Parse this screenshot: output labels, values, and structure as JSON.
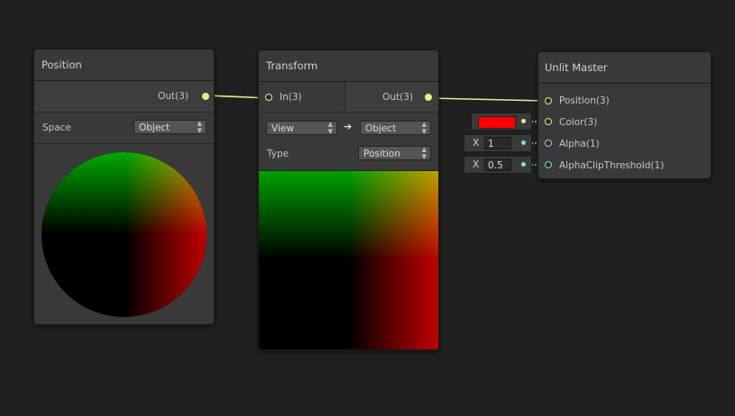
{
  "nodes": {
    "position": {
      "title": "Position",
      "out_label": "Out(3)",
      "space_label": "Space",
      "space_value": "Object"
    },
    "transform": {
      "title": "Transform",
      "in_label": "In(3)",
      "out_label": "Out(3)",
      "from_value": "View",
      "arrow": "➔",
      "to_value": "Object",
      "type_label": "Type",
      "type_value": "Position"
    },
    "unlit_master": {
      "title": "Unlit Master",
      "ports": [
        {
          "label": "Position(3)"
        },
        {
          "label": "Color(3)"
        },
        {
          "label": "Alpha(1)"
        },
        {
          "label": "AlphaClipThreshold(1)"
        }
      ]
    }
  },
  "inputs": {
    "color_swatch": "#ff0000",
    "alpha": {
      "axis": "X",
      "value": "1"
    },
    "alpha_clip": {
      "axis": "X",
      "value": "0.5"
    }
  },
  "colors": {
    "canvas": "#202020",
    "node_bg": "#393939",
    "wire": "#e6ee8a",
    "vector1_port": "#8fd6e6"
  }
}
